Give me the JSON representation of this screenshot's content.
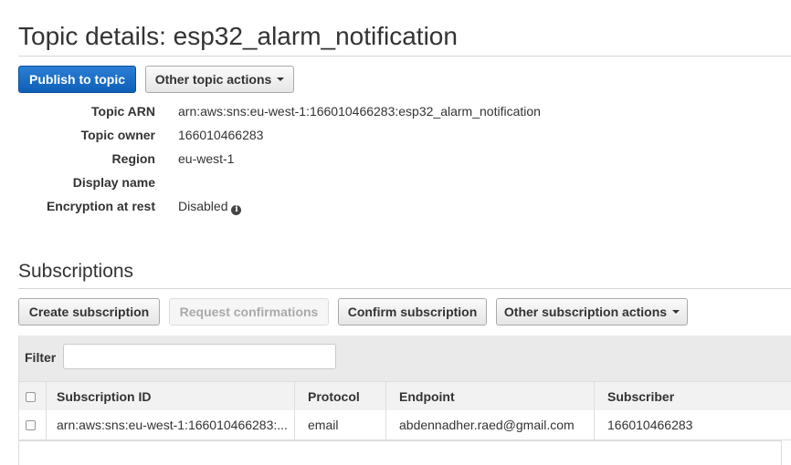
{
  "header": {
    "title": "Topic details: esp32_alarm_notification"
  },
  "topic_actions": {
    "publish_label": "Publish to topic",
    "other_label": "Other topic actions"
  },
  "details": [
    {
      "label": "Topic ARN",
      "value": "arn:aws:sns:eu-west-1:166010466283:esp32_alarm_notification"
    },
    {
      "label": "Topic owner",
      "value": "166010466283"
    },
    {
      "label": "Region",
      "value": "eu-west-1"
    },
    {
      "label": "Display name",
      "value": ""
    },
    {
      "label": "Encryption at rest",
      "value": "Disabled"
    }
  ],
  "subscriptions": {
    "title": "Subscriptions",
    "buttons": {
      "create": "Create subscription",
      "request": "Request confirmations",
      "confirm": "Confirm subscription",
      "other": "Other subscription actions"
    },
    "filter": {
      "label": "Filter",
      "value": "",
      "placeholder": ""
    },
    "columns": [
      "Subscription ID",
      "Protocol",
      "Endpoint",
      "Subscriber"
    ],
    "rows": [
      {
        "id": "arn:aws:sns:eu-west-1:166010466283:...",
        "protocol": "email",
        "endpoint": "abdennadher.raed@gmail.com",
        "subscriber": "166010466283"
      }
    ]
  },
  "icons": {
    "info": "info-icon",
    "caret": "caret-down-icon",
    "checkbox": "checkbox"
  },
  "colors": {
    "primary_button": "#1a6fc9",
    "text": "#333333",
    "header_bg": "#f2f2f2",
    "filter_bg": "#eaeaea"
  }
}
